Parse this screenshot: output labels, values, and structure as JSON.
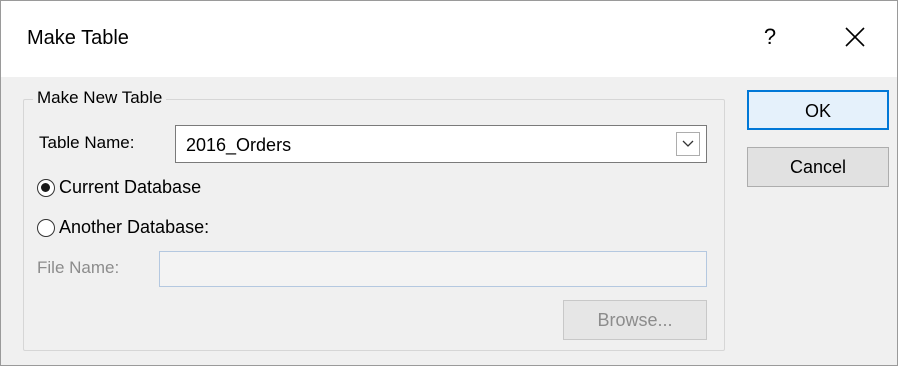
{
  "window": {
    "title": "Make Table",
    "help_label": "?",
    "close_label": "✕"
  },
  "group": {
    "legend": "Make New Table",
    "table_name_label": "Table Name:",
    "table_name_value": "2016_Orders",
    "radio_current": "Current Database",
    "radio_current_checked": true,
    "radio_another": "Another Database:",
    "radio_another_checked": false,
    "file_name_label": "File Name:",
    "file_name_value": "",
    "browse_label": "Browse..."
  },
  "buttons": {
    "ok_label": "OK",
    "cancel_label": "Cancel"
  },
  "colors": {
    "accent": "#0078d7",
    "background": "#f0f0f0",
    "disabled_text": "#8c8c8c"
  }
}
